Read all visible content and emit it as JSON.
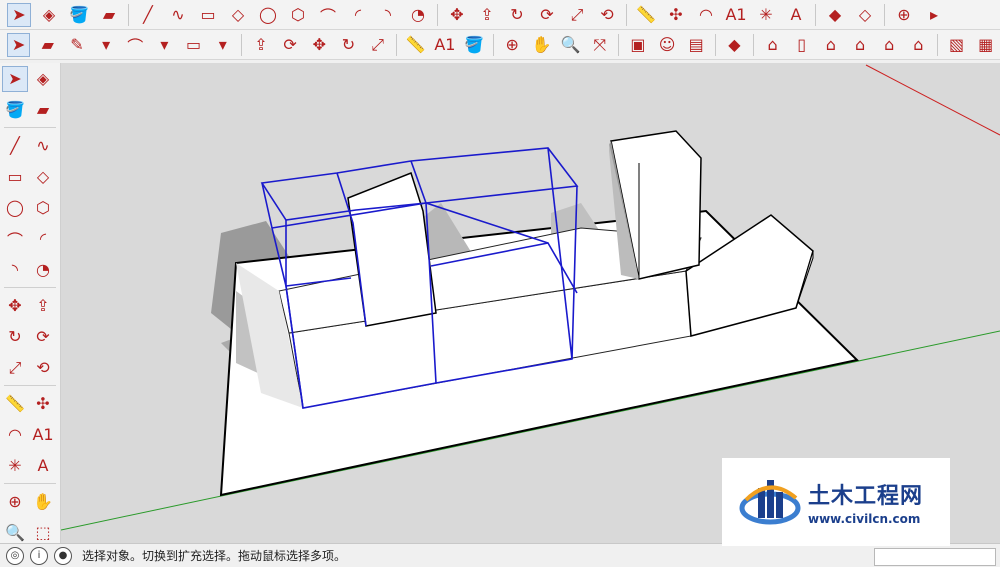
{
  "toolbar_top": [
    {
      "name": "select-icon",
      "glyph": "➤",
      "selected": true
    },
    {
      "name": "make-component-icon",
      "glyph": "◈"
    },
    {
      "name": "paint-bucket-icon",
      "glyph": "🪣"
    },
    {
      "name": "eraser-icon",
      "glyph": "▰"
    },
    {
      "sep": true
    },
    {
      "name": "line-icon",
      "glyph": "╱"
    },
    {
      "name": "freehand-icon",
      "glyph": "∿"
    },
    {
      "name": "rectangle-icon",
      "glyph": "▭"
    },
    {
      "name": "rotated-rectangle-icon",
      "glyph": "◇"
    },
    {
      "name": "circle-icon",
      "glyph": "◯"
    },
    {
      "name": "polygon-icon",
      "glyph": "⬡"
    },
    {
      "name": "arc-icon",
      "glyph": "⌒"
    },
    {
      "name": "two-point-arc-icon",
      "glyph": "◜"
    },
    {
      "name": "three-point-arc-icon",
      "glyph": "◝"
    },
    {
      "name": "pie-icon",
      "glyph": "◔"
    },
    {
      "sep": true
    },
    {
      "name": "move-icon",
      "glyph": "✥"
    },
    {
      "name": "push-pull-icon",
      "glyph": "⇪"
    },
    {
      "name": "rotate-icon",
      "glyph": "↻"
    },
    {
      "name": "follow-me-icon",
      "glyph": "⟳"
    },
    {
      "name": "scale-icon",
      "glyph": "⤢"
    },
    {
      "name": "offset-icon",
      "glyph": "⟲"
    },
    {
      "sep": true
    },
    {
      "name": "tape-measure-icon",
      "glyph": "📏"
    },
    {
      "name": "dimension-icon",
      "glyph": "✣"
    },
    {
      "name": "protractor-icon",
      "glyph": "◠"
    },
    {
      "name": "text-icon",
      "glyph": "A1"
    },
    {
      "name": "axes-icon",
      "glyph": "✳"
    },
    {
      "name": "3d-text-icon",
      "glyph": "A"
    },
    {
      "sep": true
    },
    {
      "name": "section-plane-icon",
      "glyph": "◆"
    },
    {
      "name": "display-section-icon",
      "glyph": "◇"
    },
    {
      "sep": true
    },
    {
      "name": "orbit-icon",
      "glyph": "⊕"
    },
    {
      "name": "pan-icon",
      "glyph": "▸"
    }
  ],
  "toolbar_second": [
    {
      "name": "select-icon",
      "glyph": "➤",
      "selected": true
    },
    {
      "name": "eraser-icon",
      "glyph": "▰"
    },
    {
      "name": "pencil-icon",
      "glyph": "✎"
    },
    {
      "name": "pencil-dropdown-icon",
      "glyph": "▾"
    },
    {
      "name": "arc-icon",
      "glyph": "⌒"
    },
    {
      "name": "arc-dropdown-icon",
      "glyph": "▾"
    },
    {
      "name": "rectangle-icon",
      "glyph": "▭"
    },
    {
      "name": "rectangle-dropdown-icon",
      "glyph": "▾"
    },
    {
      "sep": true
    },
    {
      "name": "push-pull-icon",
      "glyph": "⇪"
    },
    {
      "name": "follow-me-icon",
      "glyph": "⟳"
    },
    {
      "name": "move-icon",
      "glyph": "✥"
    },
    {
      "name": "rotate-icon",
      "glyph": "↻"
    },
    {
      "name": "scale-icon",
      "glyph": "⤢"
    },
    {
      "sep": true
    },
    {
      "name": "tape-measure-icon",
      "glyph": "📏"
    },
    {
      "name": "text-icon",
      "glyph": "A1"
    },
    {
      "name": "paint-bucket-icon",
      "glyph": "🪣"
    },
    {
      "sep": true
    },
    {
      "name": "orbit-icon",
      "glyph": "⊕"
    },
    {
      "name": "pan-icon",
      "glyph": "✋"
    },
    {
      "name": "zoom-icon",
      "glyph": "🔍"
    },
    {
      "name": "zoom-extents-icon",
      "glyph": "⤧"
    },
    {
      "sep": true
    },
    {
      "name": "warehouse-icon",
      "glyph": "▣"
    },
    {
      "name": "extension-icon",
      "glyph": "☺"
    },
    {
      "name": "share-model-icon",
      "glyph": "▤"
    },
    {
      "sep": true
    },
    {
      "name": "ruby-console-icon",
      "glyph": "◆"
    },
    {
      "sep": true
    },
    {
      "name": "iso-view-icon",
      "glyph": "⌂"
    },
    {
      "name": "top-view-icon",
      "glyph": "▯"
    },
    {
      "name": "front-view-icon",
      "glyph": "⌂"
    },
    {
      "name": "right-view-icon",
      "glyph": "⌂"
    },
    {
      "name": "back-view-icon",
      "glyph": "⌂"
    },
    {
      "name": "left-view-icon",
      "glyph": "⌂"
    },
    {
      "sep": true
    },
    {
      "name": "xray-icon",
      "glyph": "▧"
    },
    {
      "name": "wireframe-icon",
      "glyph": "▦"
    }
  ],
  "left_toolbar": [
    [
      "select-icon:➤:sel",
      "component-icon:◈"
    ],
    [
      "paint-bucket-icon:🪣",
      "eraser-icon:▰"
    ],
    "sep",
    [
      "line-icon:╱",
      "freehand-icon:∿"
    ],
    [
      "rectangle-icon:▭",
      "rotated-rectangle-icon:◇"
    ],
    [
      "circle-icon:◯",
      "polygon-icon:⬡"
    ],
    [
      "arc-icon:⌒",
      "two-point-arc-icon:◜"
    ],
    [
      "three-point-arc-icon:◝",
      "pie-icon:◔"
    ],
    "sep",
    [
      "move-icon:✥",
      "push-pull-icon:⇪"
    ],
    [
      "rotate-icon:↻",
      "follow-me-icon:⟳"
    ],
    [
      "scale-icon:⤢",
      "offset-icon:⟲"
    ],
    "sep",
    [
      "tape-measure-icon:📏",
      "dimension-icon:✣"
    ],
    [
      "protractor-icon:◠",
      "text-icon:A1"
    ],
    [
      "axes-icon:✳",
      "3d-text-icon:A"
    ],
    "sep",
    [
      "orbit-icon:⊕",
      "pan-icon:✋"
    ],
    [
      "zoom-icon:🔍",
      "zoom-window-icon:⬚"
    ]
  ],
  "status": {
    "text": "选择对象。切换到扩充选择。拖动鼠标选择多项。"
  },
  "watermark": {
    "title": "土木工程网",
    "url": "www.civilcn.com"
  },
  "colors": {
    "selection_blue": "#1a1acc",
    "axis_red": "#cc2020",
    "axis_green": "#2a9a2a",
    "background": "#d9d9d9"
  }
}
